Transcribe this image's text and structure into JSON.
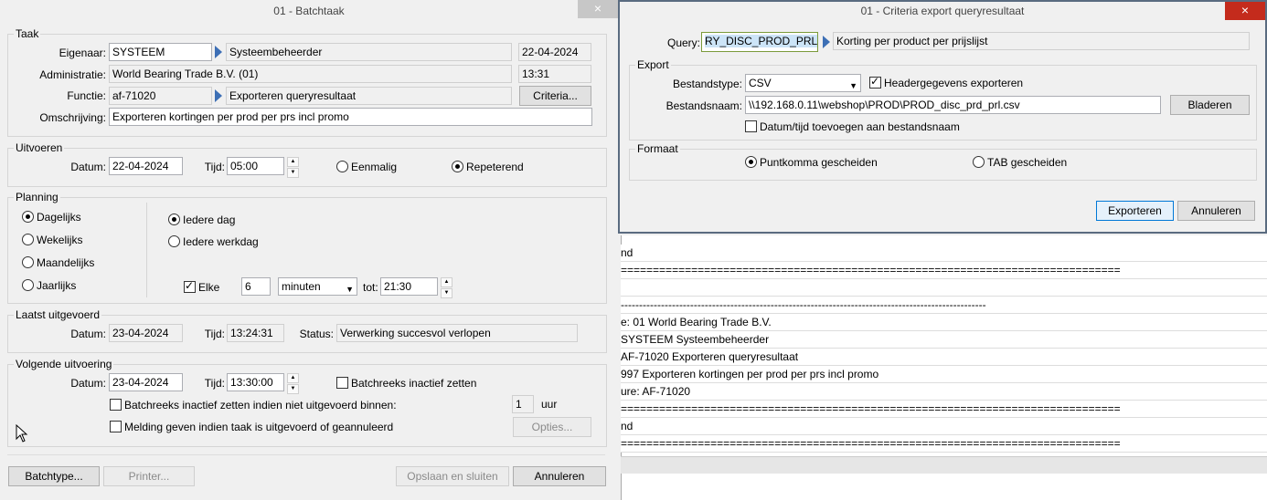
{
  "left_window": {
    "title": "01 - Batchtaak",
    "close_icon": "×",
    "taak": {
      "legend": "Taak",
      "eigenaar_label": "Eigenaar:",
      "eigenaar_code": "SYSTEEM",
      "eigenaar_name": "Systeembeheerder",
      "date": "22-04-2024",
      "administratie_label": "Administratie:",
      "administratie_value": "World Bearing Trade B.V. (01)",
      "time": "13:31",
      "functie_label": "Functie:",
      "functie_code": "af-71020",
      "functie_name": "Exporteren queryresultaat",
      "criteria_button": "Criteria...",
      "omschrijving_label": "Omschrijving:",
      "omschrijving_value": "Exporteren kortingen per prod per prs incl promo"
    },
    "uitvoeren": {
      "legend": "Uitvoeren",
      "datum_label": "Datum:",
      "datum_value": "22-04-2024",
      "tijd_label": "Tijd:",
      "tijd_value": "05:00",
      "eenmalig": "Eenmalig",
      "repeterend": "Repeterend"
    },
    "planning": {
      "legend": "Planning",
      "dagelijks": "Dagelijks",
      "wekelijks": "Wekelijks",
      "maandelijks": "Maandelijks",
      "jaarlijks": "Jaarlijks",
      "iedere_dag": "Iedere dag",
      "iedere_werkdag": "Iedere werkdag",
      "elke_label": "Elke",
      "elke_value": "6",
      "unit_value": "minuten",
      "tot_label": "tot:",
      "tot_value": "21:30"
    },
    "laatst": {
      "legend": "Laatst uitgevoerd",
      "datum_label": "Datum:",
      "datum_value": "23-04-2024",
      "tijd_label": "Tijd:",
      "tijd_value": "13:24:31",
      "status_label": "Status:",
      "status_value": "Verwerking succesvol verlopen"
    },
    "volgende": {
      "legend": "Volgende uitvoering",
      "datum_label": "Datum:",
      "datum_value": "23-04-2024",
      "tijd_label": "Tijd:",
      "tijd_value": "13:30:00",
      "inactief_label": "Batchreeks inactief zetten",
      "inactief_binnen_label": "Batchreeks inactief zetten indien niet uitgevoerd binnen:",
      "binnen_value": "1",
      "uur_label": "uur",
      "melding_label": "Melding geven indien taak is uitgevoerd of geannuleerd",
      "opties_button": "Opties..."
    },
    "footer": {
      "batchtype_button": "Batchtype...",
      "printer_button": "Printer...",
      "opslaan_button": "Opslaan en sluiten",
      "annuleren_button": "Annuleren"
    }
  },
  "right_window": {
    "title": "01 - Criteria export queryresultaat",
    "close_icon": "×",
    "query_label": "Query:",
    "query_value": "RY_DISC_PROD_PRL",
    "query_desc": "Korting per product per prijslijst",
    "export": {
      "legend": "Export",
      "bestandstype_label": "Bestandstype:",
      "bestandstype_value": "CSV",
      "header_label": "Headergegevens exporteren",
      "bestandsnaam_label": "Bestandsnaam:",
      "bestandsnaam_value": "\\\\192.168.0.11\\webshop\\PROD\\PROD_disc_prd_prl.csv",
      "bladeren_button": "Bladeren",
      "datum_tijd_label": "Datum/tijd toevoegen aan bestandsnaam"
    },
    "formaat": {
      "legend": "Formaat",
      "puntkomma": "Puntkomma gescheiden",
      "tab": "TAB gescheiden"
    },
    "exporteren_button": "Exporteren",
    "annuleren_button": "Annuleren"
  },
  "log": {
    "header": "nd",
    "lines": [
      "==============================================================================",
      "",
      "----------------------------------------------------------------------------------------------------",
      "e:     01       World Bearing Trade B.V.",
      "           SYSTEEM   Systeembeheerder",
      "           AF-71020  Exporteren queryresultaat",
      "      997     Exporteren kortingen per prod per prs incl promo",
      "ure:   AF-71020",
      "==============================================================================",
      "nd",
      "=============================================================================="
    ]
  }
}
